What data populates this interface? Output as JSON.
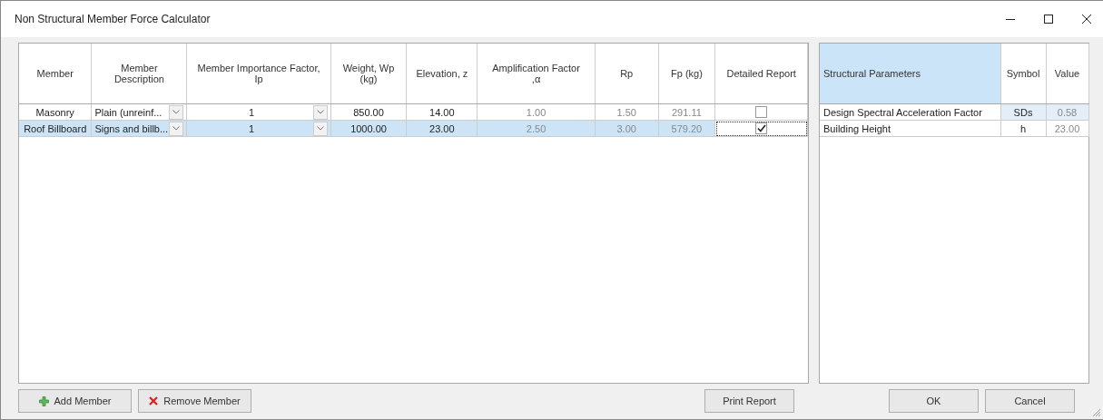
{
  "window": {
    "title": "Non Structural Member Force Calculator"
  },
  "members_table": {
    "columns": [
      {
        "label": "Member",
        "readonly": false
      },
      {
        "label": "Member Description",
        "readonly": false
      },
      {
        "label": "Member Importance Factor, Ip",
        "readonly": false
      },
      {
        "label": "Weight, Wp (kg)",
        "readonly": false
      },
      {
        "label": "Elevation, z",
        "readonly": false
      },
      {
        "label": "Amplification Factor ,α",
        "readonly": true
      },
      {
        "label": "Rp",
        "readonly": true
      },
      {
        "label": "Fp (kg)",
        "readonly": true
      },
      {
        "label": "Detailed Report",
        "readonly": false
      }
    ],
    "rows": [
      {
        "selected": false,
        "member": "Masonry",
        "description": "Plain (unreinf...",
        "importance": "1",
        "weight": "850.00",
        "elevation": "14.00",
        "amplification": "1.00",
        "rp": "1.50",
        "fp": "291.11",
        "detailed_report": false
      },
      {
        "selected": true,
        "member": "Roof Billboard",
        "description": "Signs and billb...",
        "importance": "1",
        "weight": "1000.00",
        "elevation": "23.00",
        "amplification": "2.50",
        "rp": "3.00",
        "fp": "579.20",
        "detailed_report": true
      }
    ]
  },
  "parameters_table": {
    "columns": [
      "Structural Parameters",
      "Symbol",
      "Value"
    ],
    "rows": [
      {
        "selected": true,
        "name": "Design Spectral Acceleration Factor",
        "symbol": "SDs",
        "value": "0.58"
      },
      {
        "selected": false,
        "name": "Building Height",
        "symbol": "h",
        "value": "23.00"
      }
    ]
  },
  "buttons": [
    {
      "label": "Add Member",
      "kind": "add"
    },
    {
      "label": "Remove Member",
      "kind": "remove"
    },
    {
      "label": "Print Report",
      "kind": "plain"
    },
    {
      "label": "OK",
      "kind": "plain"
    },
    {
      "label": "Cancel",
      "kind": "plain"
    }
  ]
}
